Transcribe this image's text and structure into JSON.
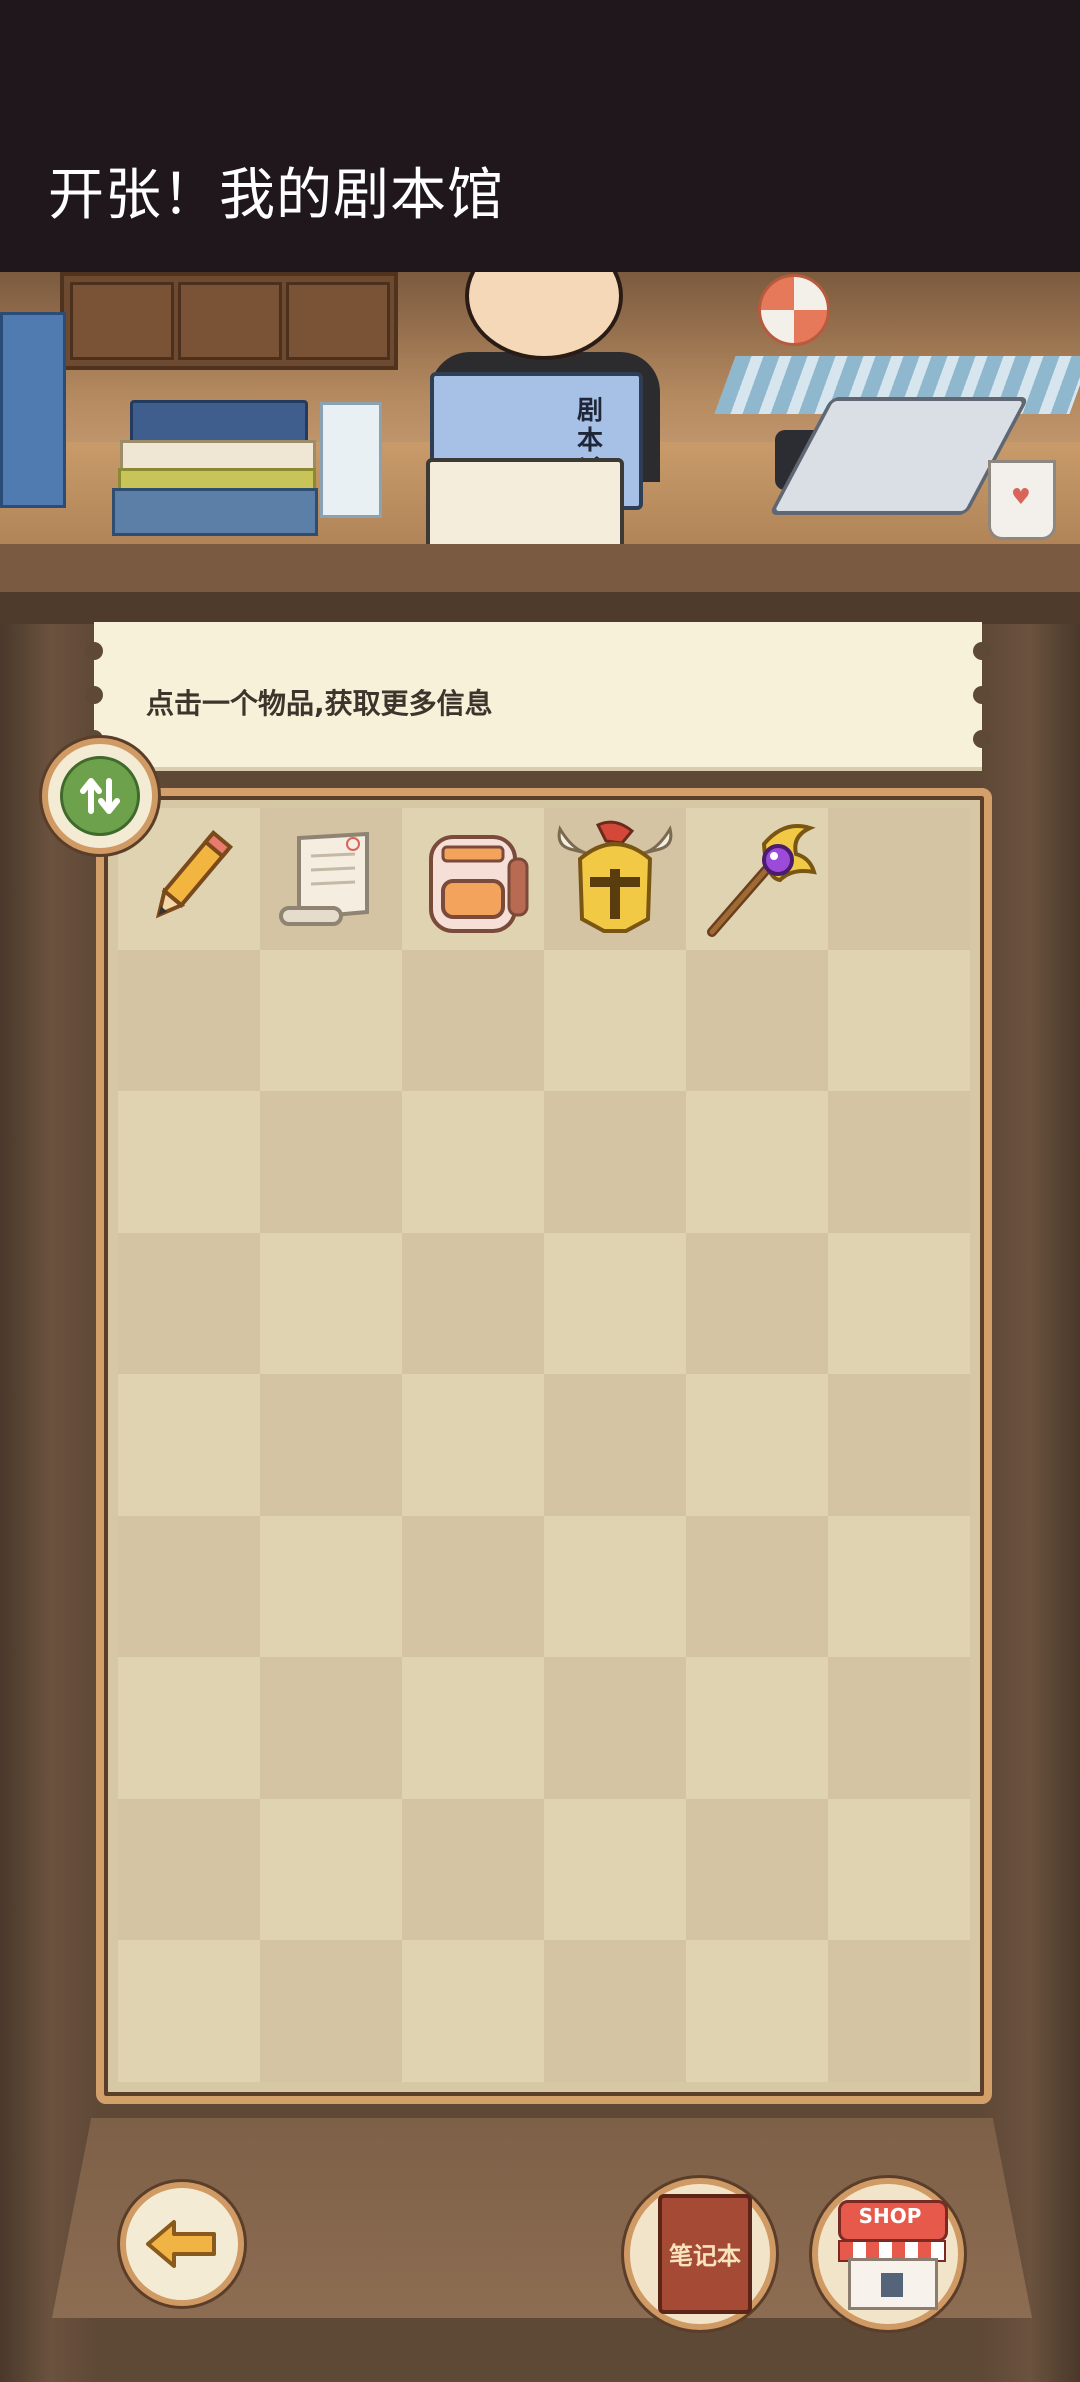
{
  "window": {
    "title": "开张！我的剧本馆"
  },
  "scene": {
    "book_label": "剧本杀"
  },
  "info": {
    "hint": "点击一个物品,获取更多信息"
  },
  "inventory": {
    "columns": 6,
    "rows": 9,
    "items": [
      {
        "name": "pencil",
        "icon": "pencil-icon"
      },
      {
        "name": "scroll",
        "icon": "scroll-icon"
      },
      {
        "name": "backpack",
        "icon": "backpack-icon"
      },
      {
        "name": "golden-helmet",
        "icon": "golden-helmet-icon"
      },
      {
        "name": "magic-staff",
        "icon": "magic-staff-icon"
      }
    ]
  },
  "buttons": {
    "sort_icon": "sort-arrows-icon",
    "back_icon": "back-arrow-icon",
    "notebook_label": "笔记本",
    "shop_label": "SHOP"
  },
  "colors": {
    "title_bar": "#1f171c",
    "banner": "#f7f1da",
    "grid_light": "#e0d3b2",
    "grid_dark": "#d4c4a3",
    "frame_border": "#d3a06a"
  }
}
